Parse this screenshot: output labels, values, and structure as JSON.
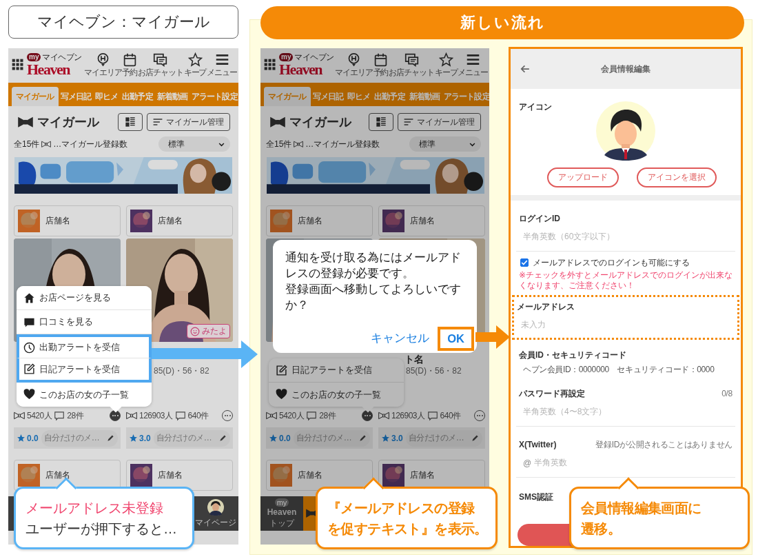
{
  "title_box": {
    "text": "マイヘブン：マイガール"
  },
  "flow_header": {
    "text": "新しい流れ"
  },
  "screens": [
    {
      "logo": {
        "badge": "my",
        "kana": "マイヘブン",
        "name": "Heaven"
      },
      "nav": [
        {
          "kind": "area",
          "label": "マイエリア"
        },
        {
          "kind": "calendar",
          "label": "予約"
        },
        {
          "kind": "chat",
          "label": "お店チャット"
        },
        {
          "kind": "star",
          "label": "キープ"
        },
        {
          "kind": "menu",
          "label": "メニュー"
        }
      ],
      "tabs": [
        {
          "label": "マイガール",
          "selected": true
        },
        {
          "label": "写メ日記",
          "selected": false
        },
        {
          "label": "即ヒメ",
          "selected": false
        },
        {
          "label": "出勤予定",
          "selected": false
        },
        {
          "label": "新着動画",
          "selected": false
        },
        {
          "label": "アラート設定",
          "selected": false
        }
      ],
      "heading": "マイガール",
      "manage_button": "マイガール管理",
      "count": "全15件",
      "count_legend": "…マイガール登録数",
      "sort": "標準",
      "shops": [
        "店舗名",
        "店舗名"
      ],
      "girls": [
        {
          "fans": "5420人",
          "reviews": "28件",
          "menu_open": true,
          "rating": "0.0",
          "memo": "自分だけのメ…"
        },
        {
          "measurements": "85(D)・56・82",
          "mitayo": "みたよ",
          "fans": "126903人",
          "reviews": "640件",
          "menu_open": false,
          "rating": "3.0",
          "memo": "自分だけのメ…"
        }
      ],
      "shops_bottom": [
        "店舗名",
        "店舗名"
      ],
      "bottom_nav": [
        {
          "kind": "mypage",
          "label": "マイページ",
          "selected": false
        }
      ],
      "menu": {
        "items": [
          {
            "kind": "home",
            "label": "お店ページを見る",
            "highlighted": false
          },
          {
            "kind": "review",
            "label": "口コミを見る",
            "highlighted": false
          },
          {
            "kind": "clock",
            "label": "出勤アラートを受信",
            "highlighted": true
          },
          {
            "kind": "edit",
            "label": "日記アラートを受信",
            "highlighted": true
          },
          {
            "kind": "heart",
            "label": "このお店の女の子一覧",
            "highlighted": false
          }
        ]
      }
    },
    {
      "logo": {
        "badge": "my",
        "kana": "マイヘブン",
        "name": "Heaven"
      },
      "nav": [
        {
          "kind": "area",
          "label": "マイエリア"
        },
        {
          "kind": "calendar",
          "label": "予約"
        },
        {
          "kind": "chat",
          "label": "お店チャット"
        },
        {
          "kind": "star",
          "label": "キープ"
        },
        {
          "kind": "menu",
          "label": "メニュー"
        }
      ],
      "tabs": [
        {
          "label": "マイガール",
          "selected": true
        },
        {
          "label": "写メ日記",
          "selected": false
        },
        {
          "label": "即ヒメ",
          "selected": false
        },
        {
          "label": "出勤予定",
          "selected": false
        },
        {
          "label": "新着動画",
          "selected": false
        },
        {
          "label": "アラート設定",
          "selected": false
        }
      ],
      "heading": "マイガール",
      "manage_button": "マイガール管理",
      "count": "全15件",
      "count_legend": "…マイガール登録数",
      "sort": "標準",
      "shops": [
        "店舗名",
        "店舗名"
      ],
      "girls": [
        {
          "fans": "5420人",
          "reviews": "28件",
          "menu_open": true,
          "rating": "0.0",
          "memo": "自分だけのメ…"
        },
        {
          "name": "ト名",
          "measurements": "85(D)・56・82",
          "fans": "126903人",
          "reviews": "640件",
          "menu_open": false,
          "rating": "3.0",
          "memo": "自分だけのメ…"
        }
      ],
      "shops_bottom": [
        "店舗名",
        "店舗名"
      ],
      "bottom_nav": [
        {
          "kind": "top",
          "logo_badge": "my",
          "logo": "Heaven",
          "label": "トップ",
          "selected": false
        },
        {
          "kind": "mygirl",
          "selected": true
        }
      ],
      "menu": {
        "items": [
          {
            "kind": "edit",
            "label": "日記アラートを受信",
            "highlighted": false
          },
          {
            "kind": "heart",
            "label": "このお店の女の子一覧",
            "highlighted": false
          }
        ]
      },
      "dialog": {
        "message": [
          "通知を受け取る為にはメールアドレスの登録が必要です。",
          "登録画面へ移動してよろしいですか？"
        ],
        "buttons": [
          {
            "label": "キャンセル",
            "highlighted": false
          },
          {
            "label": "OK",
            "highlighted": true
          }
        ]
      }
    }
  ],
  "edit_screen": {
    "title": "会員情報編集",
    "icon_label": "アイコン",
    "icon_buttons": [
      "アップロード",
      "アイコンを選択"
    ],
    "fields": [
      {
        "kind": "input",
        "label": "ログインID",
        "placeholder": "半角英数（60文字以下）",
        "highlighted": false
      },
      {
        "kind": "checkbox",
        "label": "メールアドレスでのログインも可能にする",
        "checked": true
      },
      {
        "kind": "warning",
        "text": "※チェックを外すとメールアドレスでのログインが出来なくなります、ご注意ください！"
      },
      {
        "kind": "input",
        "label": "メールアドレス",
        "placeholder": "未入力",
        "highlighted": true
      },
      {
        "kind": "info",
        "label": "会員ID・セキュリティコード",
        "value": "ヘブン会員ID：0000000　セキュリティコード：0000"
      },
      {
        "kind": "input",
        "label": "パスワード再設定",
        "counter": "0/8",
        "placeholder": "半角英数（4〜8文字）",
        "highlighted": false
      },
      {
        "kind": "input",
        "label": "X(Twitter)",
        "note": "登録IDが公開されることはありません",
        "prefix": "@",
        "placeholder": "半角英数",
        "highlighted": false
      },
      {
        "kind": "link",
        "label": "SMS認証"
      }
    ],
    "footer_button": {
      "kind": "primary"
    }
  },
  "callouts": [
    {
      "kind": "blue",
      "lines": [
        {
          "text": "メールアドレス未登録",
          "highlighted": true
        },
        {
          "text": "ユーザーが押下すると…",
          "highlighted": false
        }
      ]
    },
    {
      "kind": "orange",
      "lines": [
        {
          "text": "『メールアドレスの登録",
          "highlighted": false
        },
        {
          "text": "を促すテキスト』を表示。",
          "highlighted": false
        }
      ]
    },
    {
      "kind": "orange",
      "lines": [
        {
          "text": "会員情報編集画面に",
          "highlighted": false
        },
        {
          "text": "遷移。",
          "highlighted": false
        }
      ]
    }
  ]
}
